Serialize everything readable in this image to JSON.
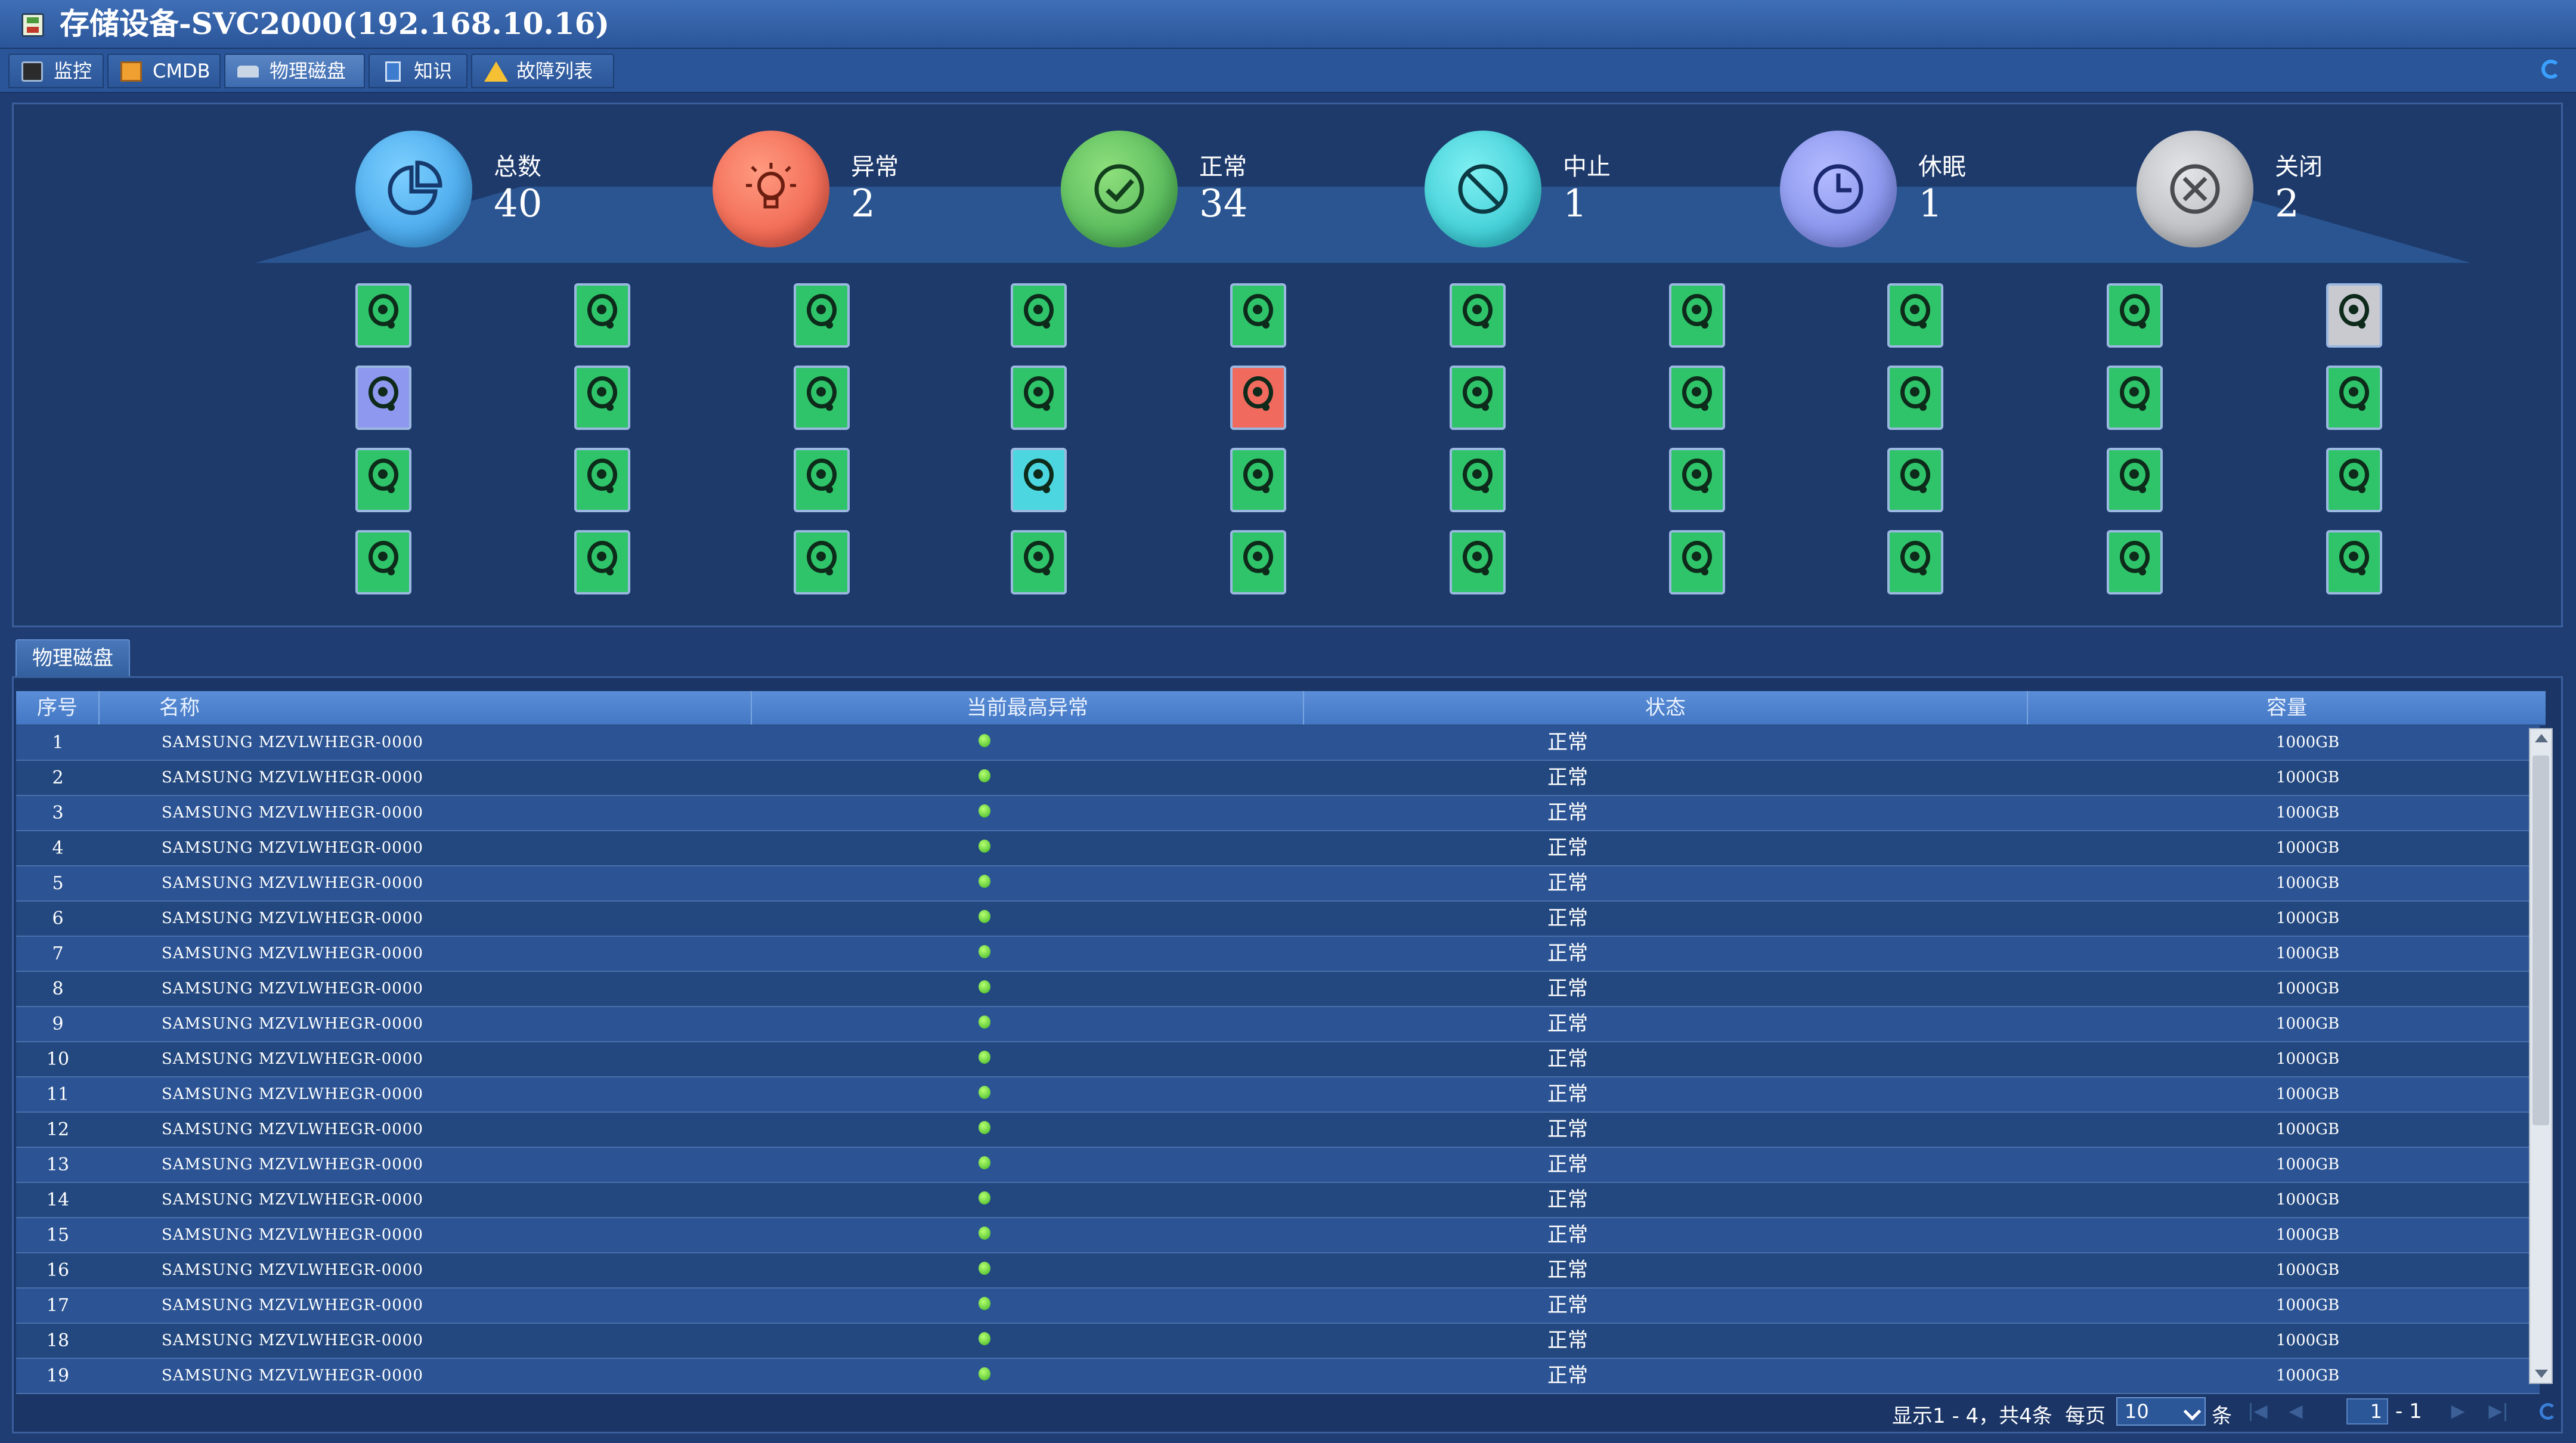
{
  "window": {
    "title": "存储设备-SVC2000(192.168.10.16)"
  },
  "tabs": [
    {
      "label": "监控",
      "icon": "monitor-icon"
    },
    {
      "label": "CMDB",
      "icon": "cmdb-icon"
    },
    {
      "label": "物理磁盘",
      "icon": "disk-icon"
    },
    {
      "label": "知识",
      "icon": "knowledge-icon"
    },
    {
      "label": "故障列表",
      "icon": "warning-icon"
    }
  ],
  "stats": [
    {
      "label": "总数",
      "value": "40",
      "color": "#3aa4ee",
      "icon": "pie-chart-icon"
    },
    {
      "label": "异常",
      "value": "2",
      "color": "#f2654f",
      "icon": "lightbulb-icon"
    },
    {
      "label": "正常",
      "value": "34",
      "color": "#46b85a",
      "icon": "check-icon"
    },
    {
      "label": "中止",
      "value": "1",
      "color": "#26c6d2",
      "icon": "ban-icon"
    },
    {
      "label": "休眠",
      "value": "1",
      "color": "#7f8de8",
      "icon": "clock-icon"
    },
    {
      "label": "关闭",
      "value": "2",
      "color": "#b6b8bd",
      "icon": "close-circle-icon"
    }
  ],
  "disk_grid": [
    [
      "normal",
      "normal",
      "normal",
      "normal",
      "normal",
      "normal",
      "normal",
      "normal",
      "normal",
      "closed"
    ],
    [
      "sleep",
      "normal",
      "normal",
      "normal",
      "abnormal",
      "normal",
      "normal",
      "normal",
      "normal",
      "normal"
    ],
    [
      "normal",
      "normal",
      "normal",
      "suspend",
      "normal",
      "normal",
      "normal",
      "normal",
      "normal",
      "normal"
    ],
    [
      "normal",
      "normal",
      "normal",
      "normal",
      "normal",
      "normal",
      "normal",
      "normal",
      "normal",
      "normal"
    ]
  ],
  "table": {
    "panel_tab": "物理磁盘",
    "columns": [
      "序号",
      "名称",
      "当前最高异常",
      "状态",
      "容量"
    ],
    "rows": [
      {
        "idx": "1",
        "name": "SAMSUNG MZVLWHEGR-0000",
        "status": "正常",
        "capacity": "1000GB"
      },
      {
        "idx": "2",
        "name": "SAMSUNG MZVLWHEGR-0000",
        "status": "正常",
        "capacity": "1000GB"
      },
      {
        "idx": "3",
        "name": "SAMSUNG MZVLWHEGR-0000",
        "status": "正常",
        "capacity": "1000GB"
      },
      {
        "idx": "4",
        "name": "SAMSUNG MZVLWHEGR-0000",
        "status": "正常",
        "capacity": "1000GB"
      },
      {
        "idx": "5",
        "name": "SAMSUNG MZVLWHEGR-0000",
        "status": "正常",
        "capacity": "1000GB"
      },
      {
        "idx": "6",
        "name": "SAMSUNG MZVLWHEGR-0000",
        "status": "正常",
        "capacity": "1000GB"
      },
      {
        "idx": "7",
        "name": "SAMSUNG MZVLWHEGR-0000",
        "status": "正常",
        "capacity": "1000GB"
      },
      {
        "idx": "8",
        "name": "SAMSUNG MZVLWHEGR-0000",
        "status": "正常",
        "capacity": "1000GB"
      },
      {
        "idx": "9",
        "name": "SAMSUNG MZVLWHEGR-0000",
        "status": "正常",
        "capacity": "1000GB"
      },
      {
        "idx": "10",
        "name": "SAMSUNG MZVLWHEGR-0000",
        "status": "正常",
        "capacity": "1000GB"
      },
      {
        "idx": "11",
        "name": "SAMSUNG MZVLWHEGR-0000",
        "status": "正常",
        "capacity": "1000GB"
      },
      {
        "idx": "12",
        "name": "SAMSUNG MZVLWHEGR-0000",
        "status": "正常",
        "capacity": "1000GB"
      },
      {
        "idx": "13",
        "name": "SAMSUNG MZVLWHEGR-0000",
        "status": "正常",
        "capacity": "1000GB"
      },
      {
        "idx": "14",
        "name": "SAMSUNG MZVLWHEGR-0000",
        "status": "正常",
        "capacity": "1000GB"
      },
      {
        "idx": "15",
        "name": "SAMSUNG MZVLWHEGR-0000",
        "status": "正常",
        "capacity": "1000GB"
      },
      {
        "idx": "16",
        "name": "SAMSUNG MZVLWHEGR-0000",
        "status": "正常",
        "capacity": "1000GB"
      },
      {
        "idx": "17",
        "name": "SAMSUNG MZVLWHEGR-0000",
        "status": "正常",
        "capacity": "1000GB"
      },
      {
        "idx": "18",
        "name": "SAMSUNG MZVLWHEGR-0000",
        "status": "正常",
        "capacity": "1000GB"
      },
      {
        "idx": "19",
        "name": "SAMSUNG MZVLWHEGR-0000",
        "status": "正常",
        "capacity": "1000GB"
      }
    ]
  },
  "pager": {
    "display_text": "显示1 - 4，共4条",
    "per_page_label": "每页",
    "per_page_value": "10",
    "per_page_unit": "条",
    "current_page": "1",
    "total_pages_text": "- 1"
  }
}
